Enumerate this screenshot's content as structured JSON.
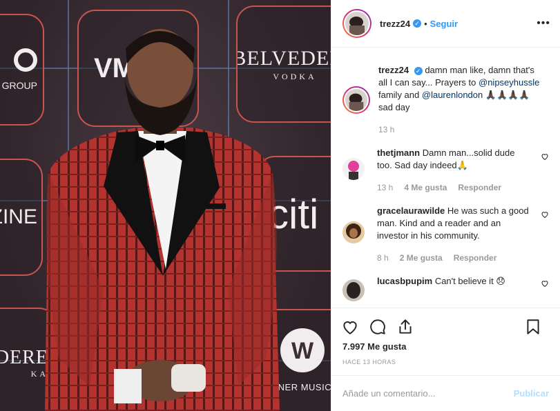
{
  "photo": {
    "logos": {
      "logo_v": "VM",
      "belvedere": "BELVEDERE",
      "vodka": "VODKA",
      "music_group": "C GROUP",
      "azine": "AZINE",
      "citi": "citi",
      "vedere_bottom": "DERE",
      "vodka_bottom": "KA",
      "warner": "WARNER MUSIC GR"
    },
    "colors": {
      "suit": "#b4332f",
      "background": "#3b2e34",
      "tile_border": "#c9554f"
    }
  },
  "header": {
    "username": "trezz24",
    "separator": "•",
    "follow_label": "Seguir",
    "more_icon": "more-horizontal-icon"
  },
  "caption": {
    "username": "trezz24",
    "text_1": "damn man like, damn that's all I can say... Prayers to",
    "mention_1": "@nipseyhussle",
    "text_2": "family and",
    "mention_2": "@laurenlondon",
    "text_3": "🙏🏿🙏🏿🙏🏿🙏🏿 sad day",
    "time": "13 h"
  },
  "comments": [
    {
      "username": "thetjmann",
      "text": "Damn man...solid dude too. Sad day indeed🙏",
      "time": "13 h",
      "likes": "4 Me gusta",
      "reply": "Responder"
    },
    {
      "username": "gracelaurawilde",
      "text": "He was such a good man. Kind and a reader and an investor in his community.",
      "time": "8 h",
      "likes": "2 Me gusta",
      "reply": "Responder"
    },
    {
      "username": "lucasbpupim",
      "text": "Can't believe it 😞"
    }
  ],
  "actions": {
    "like_icon": "heart-icon",
    "comment_icon": "comment-icon",
    "share_icon": "share-icon",
    "save_icon": "bookmark-icon"
  },
  "likes": "7.997 Me gusta",
  "timestamp": "HACE 13 HORAS",
  "add_comment": {
    "placeholder": "Añade un comentario...",
    "publish_label": "Publicar"
  },
  "accent": {
    "link": "#3897f0",
    "mention": "#003569",
    "muted": "#999999",
    "publish_disabled": "#b2dffc"
  }
}
